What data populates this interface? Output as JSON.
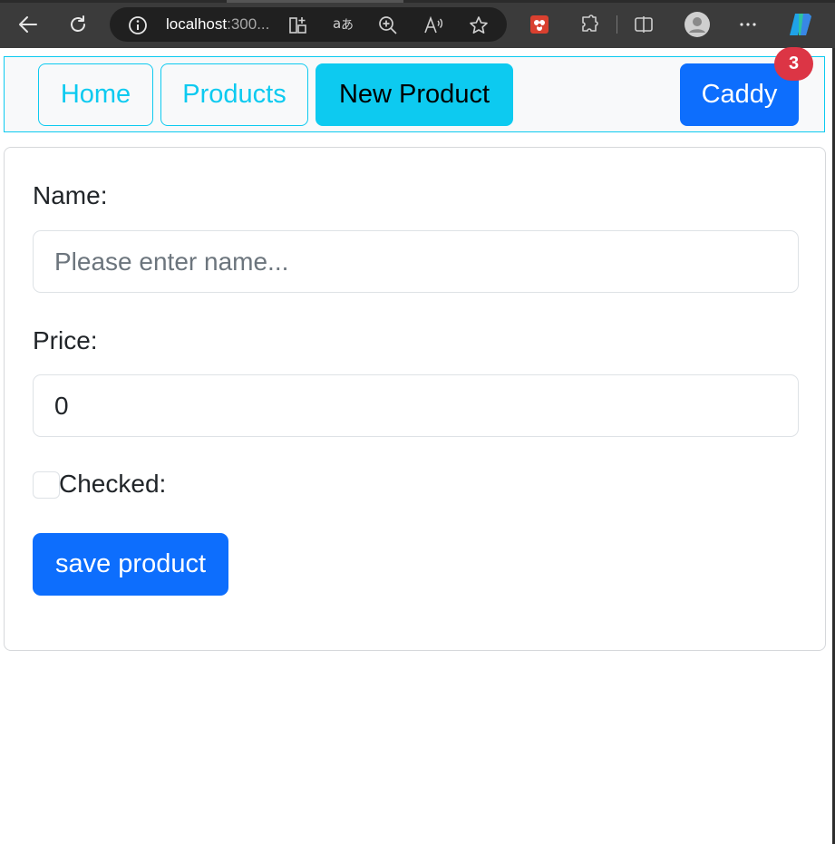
{
  "browser": {
    "url_host": "localhost",
    "url_port": ":300...",
    "icons": [
      "back-icon",
      "refresh-icon",
      "info-icon",
      "app-grid-icon",
      "translate-icon",
      "zoom-icon",
      "read-aloud-icon",
      "favorite-star-icon",
      "extension-app-icon",
      "extensions-puzzle-icon",
      "split-screen-icon",
      "profile-avatar-icon",
      "more-options-icon",
      "copilot-icon"
    ]
  },
  "nav": {
    "home": "Home",
    "products": "Products",
    "new_product": "New Product",
    "cart": "Caddy",
    "cart_count": "3"
  },
  "form": {
    "name_label": "Name:",
    "name_placeholder": "Please enter name...",
    "price_label": "Price:",
    "price_value": "0",
    "checked_label": "Checked:",
    "save_label": "save product"
  },
  "colors": {
    "info": "#0dcaf0",
    "primary": "#0d6efd",
    "danger": "#dc3545"
  }
}
